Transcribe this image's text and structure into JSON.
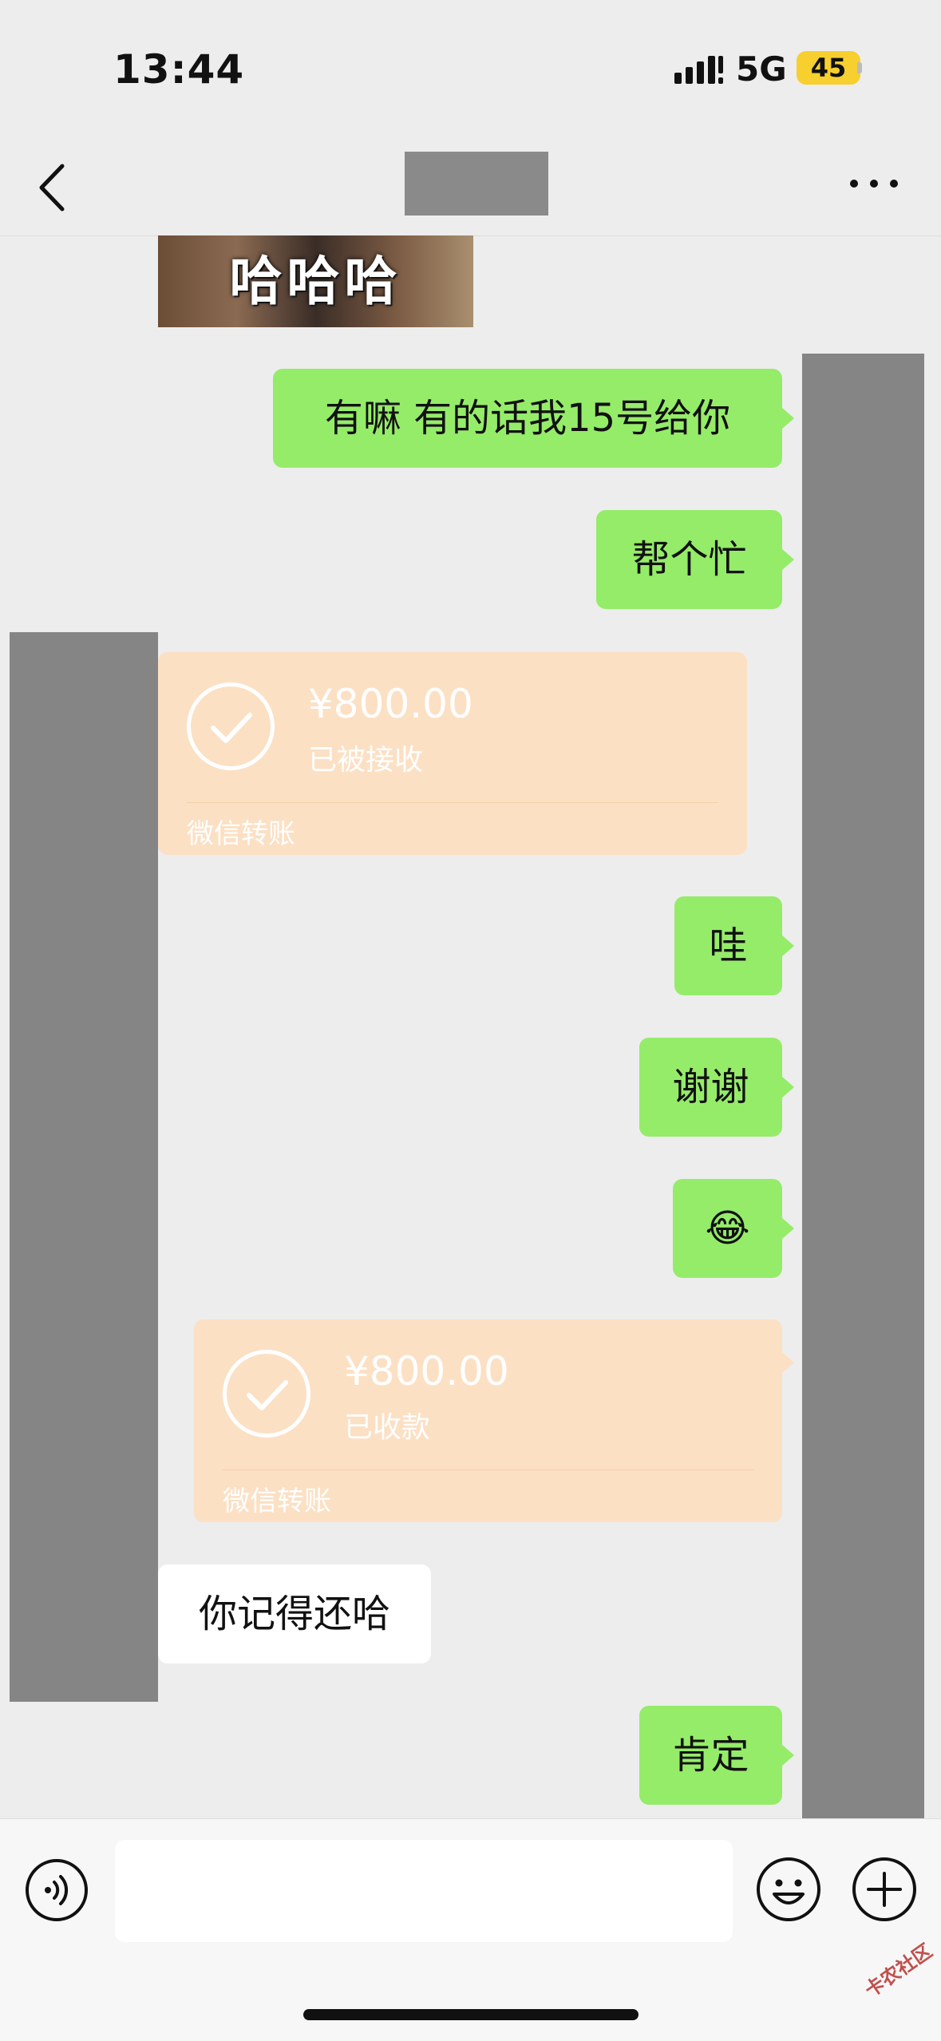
{
  "status_bar": {
    "time": "13:44",
    "network": "5G",
    "battery": "45",
    "battery_color": "#f7cf2e"
  },
  "nav": {
    "back_icon": "chevron-left-icon",
    "more_icon": "more-horizontal-icon"
  },
  "colors": {
    "background": "#ededed",
    "outgoing_bubble": "#95ec69",
    "incoming_bubble": "#ffffff",
    "transfer_card": "#fce0c4",
    "redaction": "#858585"
  },
  "messages": {
    "sticker_text": "哈哈哈",
    "m1": "有嘛 有的话我15号给你",
    "m2": "帮个忙",
    "transfer1": {
      "amount": "¥800.00",
      "status": "已被接收",
      "label": "微信转账"
    },
    "m3": "哇",
    "m4": "谢谢",
    "m5_emoji": "😂",
    "transfer2": {
      "amount": "¥800.00",
      "status": "已收款",
      "label": "微信转账"
    },
    "m6": "你记得还哈",
    "m7": "肯定"
  },
  "input_bar": {
    "voice_icon": "voice-icon",
    "emoji_icon": "emoji-icon",
    "plus_icon": "plus-icon",
    "input_value": ""
  },
  "watermark": "卡农社区"
}
